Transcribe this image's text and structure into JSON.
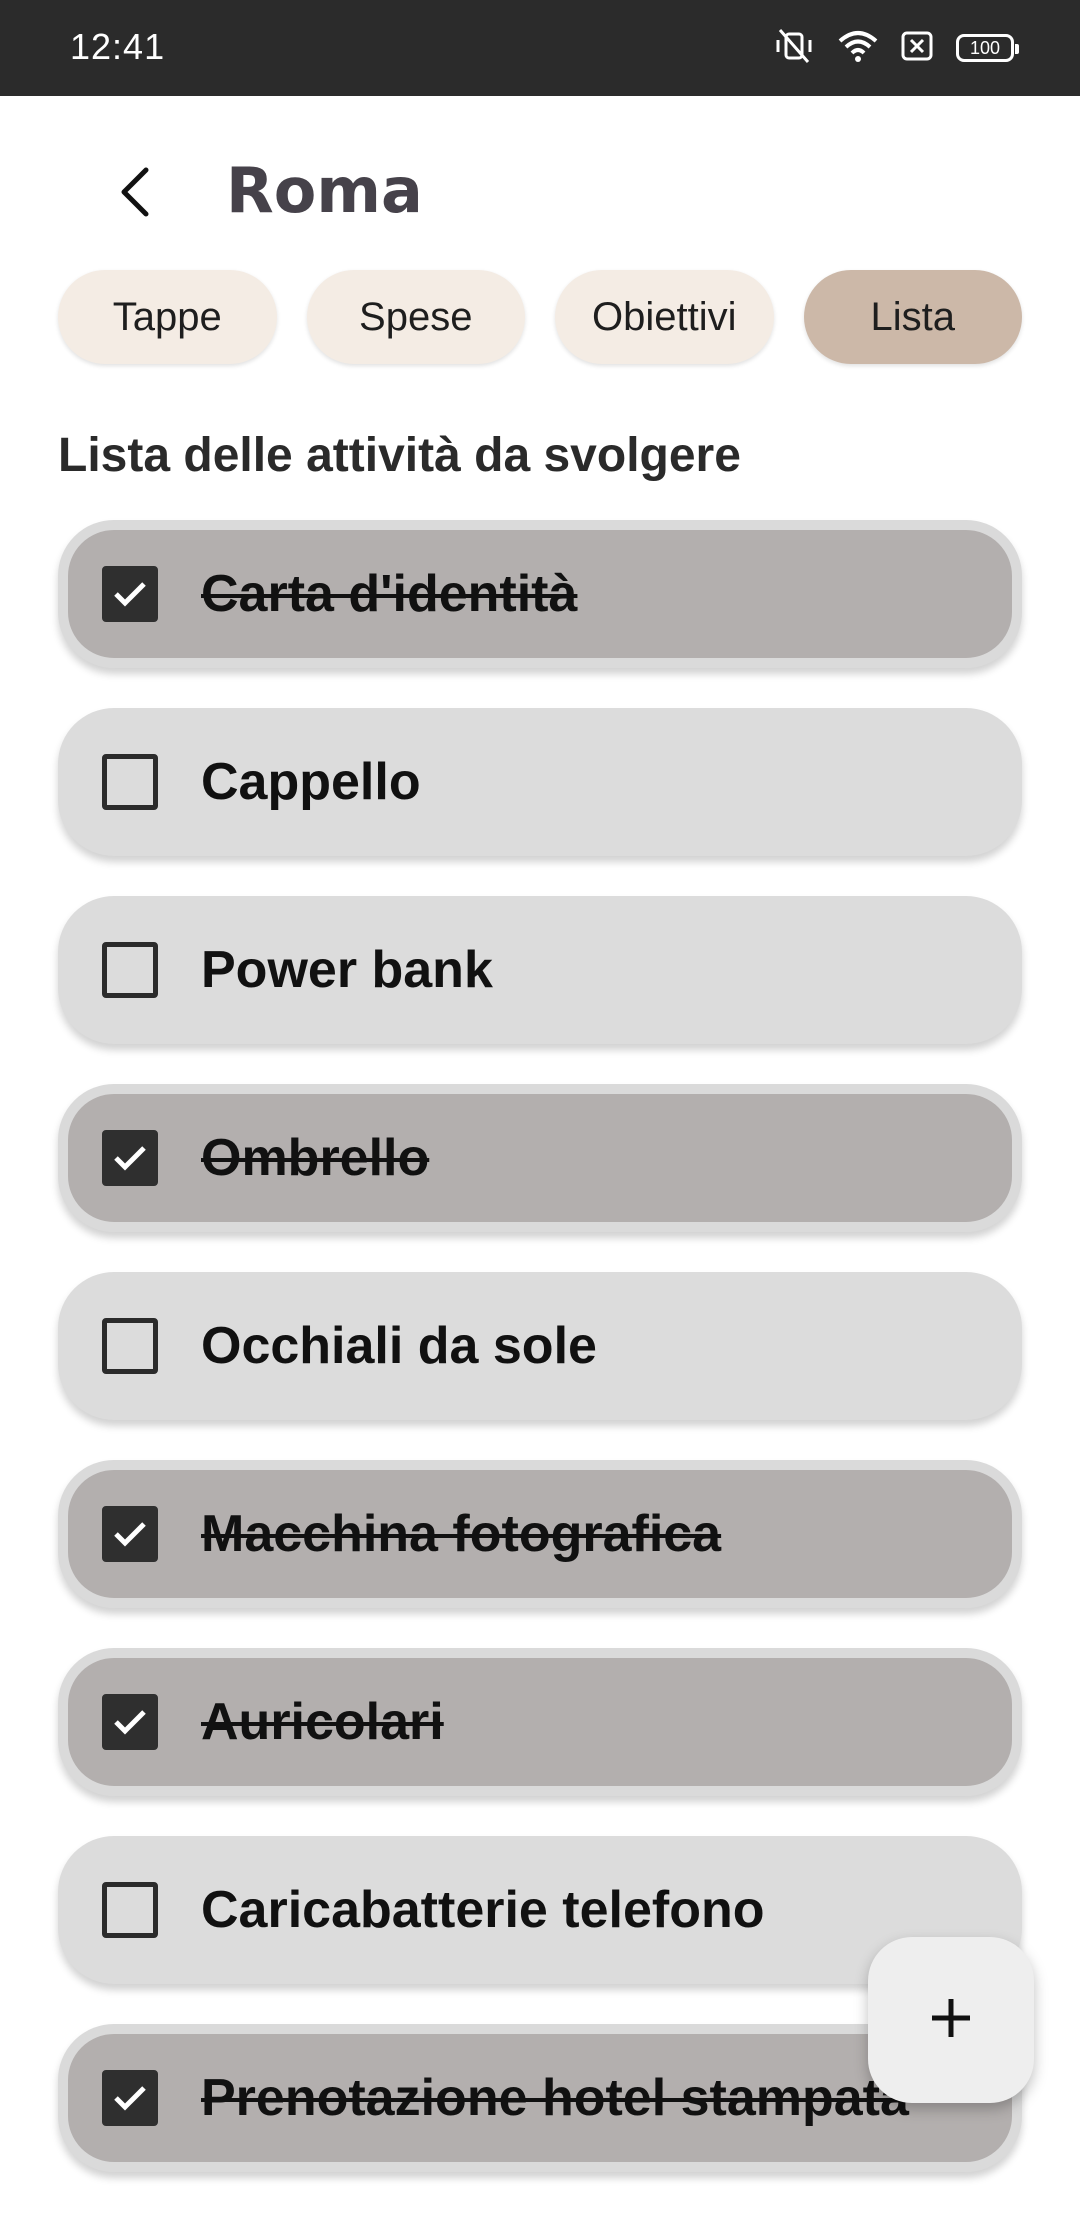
{
  "status_bar": {
    "time": "12:41",
    "battery": "100",
    "icons": [
      "vibrate-off-icon",
      "wifi-icon",
      "sim-off-icon",
      "battery-icon"
    ]
  },
  "header": {
    "title": "Roma",
    "back_icon": "back-arrow-icon"
  },
  "tabs": [
    {
      "label": "Tappe",
      "active": false
    },
    {
      "label": "Spese",
      "active": false
    },
    {
      "label": "Obiettivi",
      "active": false
    },
    {
      "label": "Lista",
      "active": true
    }
  ],
  "section_title": "Lista delle attività da svolgere",
  "items": [
    {
      "label": "Carta d'identità",
      "checked": true
    },
    {
      "label": "Cappello",
      "checked": false
    },
    {
      "label": "Power bank",
      "checked": false
    },
    {
      "label": "Ombrello",
      "checked": true
    },
    {
      "label": "Occhiali da sole",
      "checked": false
    },
    {
      "label": "Macchina fotografica",
      "checked": true
    },
    {
      "label": "Auricolari",
      "checked": true
    },
    {
      "label": "Caricabatterie telefono",
      "checked": false
    },
    {
      "label": "Prenotazione hotel stampata",
      "checked": true
    }
  ],
  "fab": {
    "icon": "plus-icon"
  },
  "colors": {
    "status_bar": "#2b2b2b",
    "tab_inactive": "#f4ece4",
    "tab_active": "#ccb8a8",
    "item_unchecked": "#dcdcdc",
    "item_checked": "#b3afae",
    "title": "#46424a"
  }
}
